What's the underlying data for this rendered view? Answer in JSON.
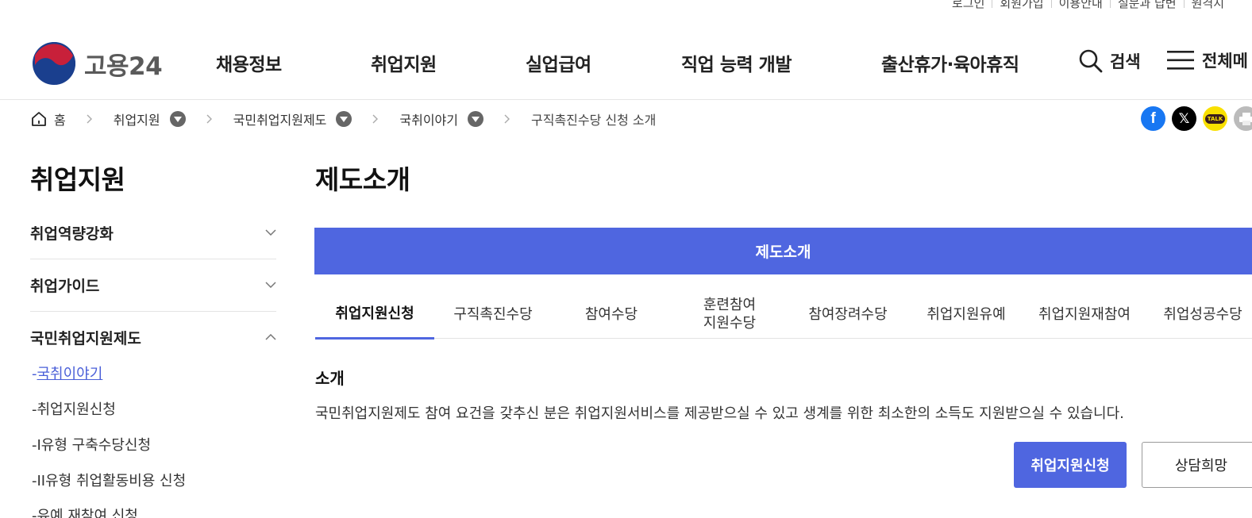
{
  "util_nav": [
    "로그인",
    "회원가입",
    "이용안내",
    "실문과 답변",
    "원격지"
  ],
  "brand": {
    "name": "고용24",
    "logo_colors": [
      "#c8203a",
      "#1a3f8e"
    ]
  },
  "gnb": [
    "채용정보",
    "취업지원",
    "실업급여",
    "직업 능력 개발",
    "출산휴가·육아휴직"
  ],
  "header_actions": {
    "search": "검색",
    "all_menu": "전체메"
  },
  "breadcrumb": {
    "home": "홈",
    "items": [
      "취업지원",
      "국민취업지원제도",
      "국취이야기",
      "구직촉진수당 신청 소개"
    ]
  },
  "share_icons": [
    "facebook-icon",
    "x-icon",
    "kakaotalk-icon",
    "print-icon"
  ],
  "share": {
    "kakao_label": "TALK"
  },
  "sidebar": {
    "title": "취업지원",
    "groups": [
      {
        "label": "취업역량강화",
        "expanded": false
      },
      {
        "label": "취업가이드",
        "expanded": false
      },
      {
        "label": "국민취업지원제도",
        "expanded": true
      }
    ],
    "sub_prefix": "-",
    "sub_items": [
      "국취이야기",
      "취업지원신청",
      "I유형 구축수당신청",
      "II유형 취업활동비용 신청",
      "유예 재참여 신청"
    ]
  },
  "main": {
    "title": "제도소개",
    "banner": "제도소개",
    "tabs": [
      {
        "label": "취업지원신청",
        "active": true
      },
      {
        "label": "구직촉진수당",
        "active": false
      },
      {
        "label": "참여수당",
        "active": false
      },
      {
        "label": "훈련참여\n지원수당",
        "active": false
      },
      {
        "label": "참여장려수당",
        "active": false
      },
      {
        "label": "취업지원유예",
        "active": false
      },
      {
        "label": "취업지원재참여",
        "active": false
      },
      {
        "label": "취업성공수당",
        "active": false
      }
    ],
    "section_title": "소개",
    "section_desc": "국민취업지원제도 참여 요건을 갖추신 분은 취업지원서비스를 제공받으실 수 있고 생계를 위한 최소한의 소득도 지원받으실 수 있습니다.",
    "primary_button": "취업지원신청",
    "secondary_button": "상담희망"
  },
  "colors": {
    "accent": "#4f66e0",
    "active_link": "#4a5fd8"
  }
}
